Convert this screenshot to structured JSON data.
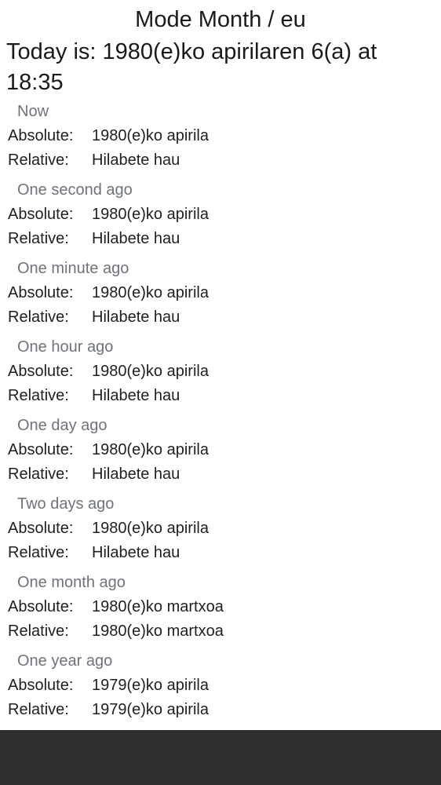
{
  "header": {
    "title": "Mode Month / eu",
    "today": "Today is: 1980(e)ko apirilaren 6(a) at 18:35"
  },
  "labels": {
    "absolute": "Absolute:",
    "relative": "Relative:"
  },
  "sections": [
    {
      "title": "Now",
      "absolute": "1980(e)ko apirila",
      "relative": "Hilabete hau"
    },
    {
      "title": "One second ago",
      "absolute": "1980(e)ko apirila",
      "relative": "Hilabete hau"
    },
    {
      "title": "One minute ago",
      "absolute": "1980(e)ko apirila",
      "relative": "Hilabete hau"
    },
    {
      "title": "One hour ago",
      "absolute": "1980(e)ko apirila",
      "relative": "Hilabete hau"
    },
    {
      "title": "One day ago",
      "absolute": "1980(e)ko apirila",
      "relative": "Hilabete hau"
    },
    {
      "title": "Two days ago",
      "absolute": "1980(e)ko apirila",
      "relative": "Hilabete hau"
    },
    {
      "title": "One month ago",
      "absolute": "1980(e)ko martxoa",
      "relative": "1980(e)ko martxoa"
    },
    {
      "title": "One year ago",
      "absolute": "1979(e)ko apirila",
      "relative": "1979(e)ko apirila"
    }
  ]
}
